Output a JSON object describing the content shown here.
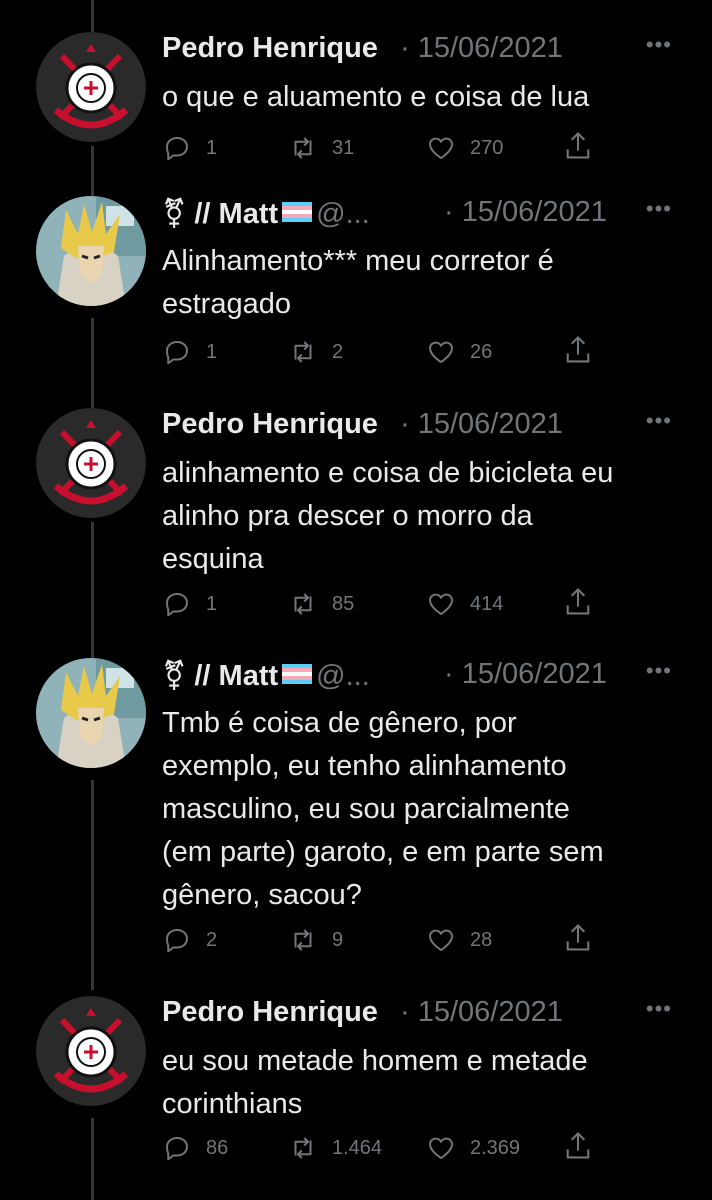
{
  "tweets": [
    {
      "author": "Pedro Henrique",
      "handle": "",
      "date": "· 15/06/2021",
      "text_lines": [
        "o que e aluamento e coisa de lua"
      ],
      "replies": "1",
      "retweets": "31",
      "likes": "270"
    },
    {
      "author": "// Matt",
      "handle": "@...",
      "date": "· 15/06/2021",
      "text_lines": [
        "Alinhamento*** meu corretor é",
        "estragado"
      ],
      "replies": "1",
      "retweets": "2",
      "likes": "26"
    },
    {
      "author": "Pedro Henrique",
      "handle": "",
      "date": "· 15/06/2021",
      "text_lines": [
        "alinhamento e coisa de bicicleta eu",
        "alinho pra descer o morro da",
        "esquina"
      ],
      "replies": "1",
      "retweets": "85",
      "likes": "414"
    },
    {
      "author": "// Matt",
      "handle": "@...",
      "date": "· 15/06/2021",
      "text_lines": [
        "Tmb é coisa de gênero, por",
        "exemplo, eu tenho alinhamento",
        "masculino, eu sou parcialmente",
        "(em parte) garoto, e em parte sem",
        "gênero, sacou?"
      ],
      "replies": "2",
      "retweets": "9",
      "likes": "28"
    },
    {
      "author": "Pedro Henrique",
      "handle": "",
      "date": "· 15/06/2021",
      "text_lines": [
        "eu sou metade homem e metade",
        "corinthians"
      ],
      "replies": "86",
      "retweets": "1.464",
      "likes": "2.369"
    }
  ],
  "icons": {
    "reply": "reply-icon",
    "retweet": "retweet-icon",
    "like": "heart-icon",
    "share": "share-icon",
    "more": "more-icon",
    "gender": "gender-symbol-icon",
    "flag": "trans-flag-icon"
  },
  "more_label": "•••",
  "gender_glyph": "⚧",
  "colors": {
    "background": "#000000",
    "text": "#e7e9ea",
    "secondary": "#71767b",
    "thread": "#333639"
  }
}
